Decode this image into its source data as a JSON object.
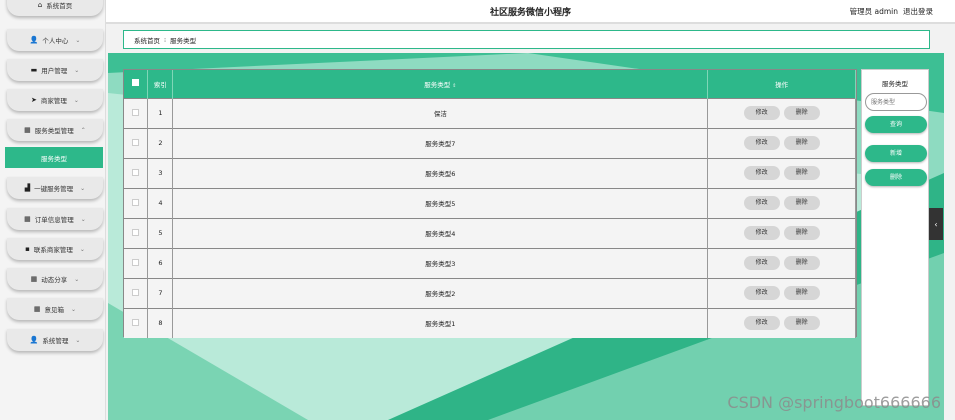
{
  "header": {
    "title": "社区服务微信小程序",
    "user_label": "管理员 admin",
    "logout_label": "退出登录"
  },
  "sidebar": {
    "items": [
      {
        "label": "系统首页",
        "icon": "home-icon",
        "glyph": "⌂",
        "chevron": ""
      },
      {
        "label": "个人中心",
        "icon": "user-icon",
        "glyph": "👤",
        "chevron": "⌄"
      },
      {
        "label": "用户管理",
        "icon": "folder-icon",
        "glyph": "▬",
        "chevron": "⌄"
      },
      {
        "label": "商家管理",
        "icon": "send-icon",
        "glyph": "➤",
        "chevron": "⌄"
      },
      {
        "label": "服务类型管理",
        "icon": "grid-icon",
        "glyph": "▦",
        "chevron": "⌃"
      },
      {
        "label": "一键服务管理",
        "icon": "thumb-icon",
        "glyph": "▟",
        "chevron": "⌄"
      },
      {
        "label": "订单信息管理",
        "icon": "grid-icon",
        "glyph": "▦",
        "chevron": "⌄"
      },
      {
        "label": "联系商家管理",
        "icon": "chat-icon",
        "glyph": "▪",
        "chevron": "⌄"
      },
      {
        "label": "动态分享",
        "icon": "grid-icon",
        "glyph": "▦",
        "chevron": "⌄"
      },
      {
        "label": "意见箱",
        "icon": "grid-icon",
        "glyph": "▦",
        "chevron": "⌄"
      },
      {
        "label": "系统管理",
        "icon": "user-icon",
        "glyph": "👤",
        "chevron": "⌄"
      }
    ],
    "active_sub": "服务类型"
  },
  "breadcrumb": {
    "home": "系统首页",
    "separator": "⁝",
    "current": "服务类型"
  },
  "table": {
    "headers": {
      "index": "索引",
      "type": "服务类型",
      "sort_icon": "⇕",
      "actions": "操作"
    },
    "rows": [
      {
        "index": "1",
        "type": "保洁"
      },
      {
        "index": "2",
        "type": "服务类型7"
      },
      {
        "index": "3",
        "type": "服务类型6"
      },
      {
        "index": "4",
        "type": "服务类型5"
      },
      {
        "index": "5",
        "type": "服务类型4"
      },
      {
        "index": "6",
        "type": "服务类型3"
      },
      {
        "index": "7",
        "type": "服务类型2"
      },
      {
        "index": "8",
        "type": "服务类型1"
      }
    ],
    "edit_label": "修改",
    "delete_label": "删除"
  },
  "search_panel": {
    "title": "服务类型",
    "placeholder": "服务类型",
    "query_label": "查询",
    "add_label": "新增",
    "delete_label": "删除"
  },
  "collapse_glyph": "‹",
  "watermark": "CSDN @springboot666666",
  "colors": {
    "accent": "#2db88a",
    "background": "#b8e8d6"
  }
}
